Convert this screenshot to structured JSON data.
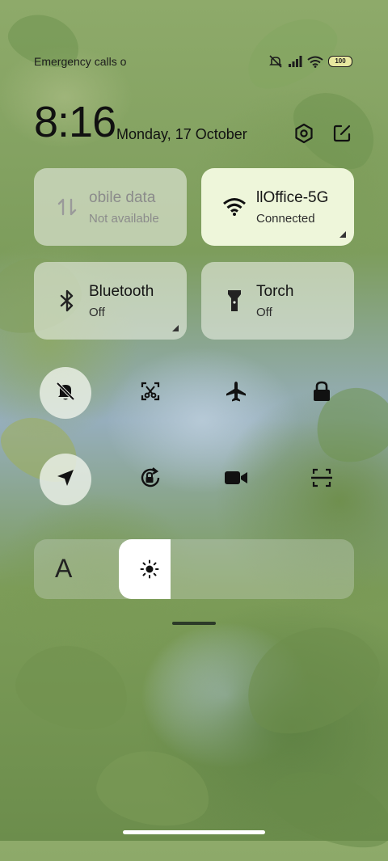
{
  "status_bar": {
    "left_text": "Emergency calls o",
    "battery_level": "100",
    "icons": [
      "mute-icon",
      "signal-icon",
      "wifi-icon",
      "battery-icon"
    ]
  },
  "header": {
    "time": "8:16",
    "date": "Monday, 17 October",
    "icons": [
      "settings-icon",
      "edit-icon"
    ]
  },
  "tiles": [
    {
      "title": "obile data",
      "subtitle": "Not available",
      "icon": "mobile-data-icon",
      "active": false
    },
    {
      "title": "llOffice-5G",
      "subtitle": "Connected",
      "icon": "wifi-icon",
      "active": true
    },
    {
      "title": "Bluetooth",
      "subtitle": "Off",
      "icon": "bluetooth-icon",
      "active": false
    },
    {
      "title": "Torch",
      "subtitle": "Off",
      "icon": "torch-icon",
      "active": false
    }
  ],
  "toggles_row1": [
    "silent-mode-icon",
    "screenshot-icon",
    "airplane-icon",
    "lock-icon"
  ],
  "toggles_row2": [
    "location-icon",
    "auto-rotate-icon",
    "video-call-icon",
    "scanner-icon"
  ],
  "brightness": {
    "auto_label": "A",
    "level": 0.07
  },
  "colors": {
    "active_tile": "#eef6da",
    "tile": "#e6ece1",
    "text": "#151515"
  }
}
